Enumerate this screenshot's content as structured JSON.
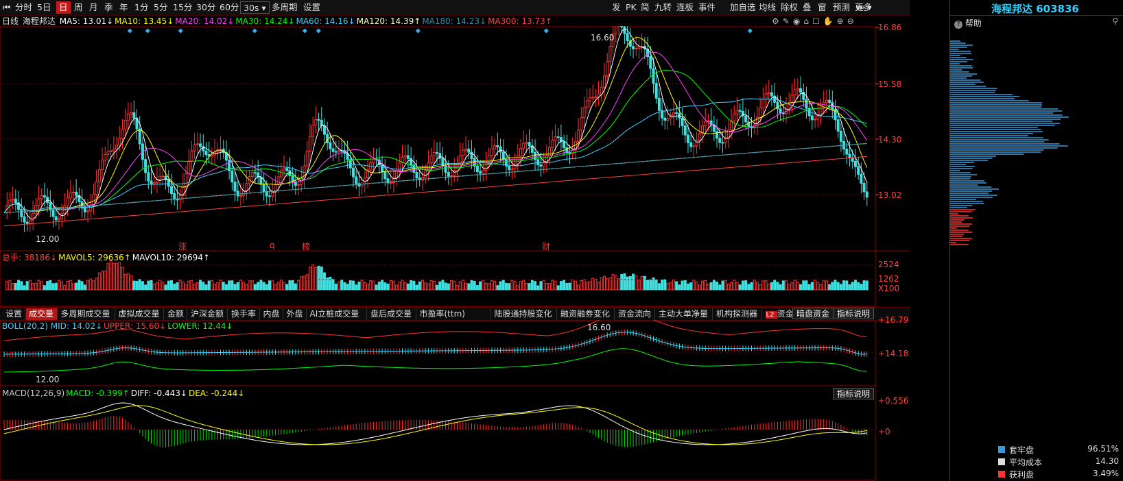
{
  "toolbar": {
    "items": [
      "分时",
      "5日",
      "日",
      "周",
      "月",
      "季",
      "年",
      "1分",
      "5分",
      "15分",
      "30分",
      "60分",
      "30s",
      "多周期",
      "设置"
    ],
    "active_index": 2,
    "right_items": [
      "发",
      "PK",
      "简",
      "九转",
      "连板",
      "事件",
      "加自选",
      "均线",
      "除权",
      "叠",
      "窗",
      "预测",
      "更多"
    ]
  },
  "stock": {
    "name": "海程邦达",
    "code": "603836"
  },
  "main_legend": {
    "period": "日线",
    "name": "海程邦达",
    "items": [
      {
        "text": "MA5: 13.01",
        "arrow": "↓",
        "color": "#ffffff"
      },
      {
        "text": "MA10: 13.45",
        "arrow": "↓",
        "color": "#ffff00"
      },
      {
        "text": "MA20: 14.02",
        "arrow": "↓",
        "color": "#ff40ff"
      },
      {
        "text": "MA30: 14.24",
        "arrow": "↓",
        "color": "#00ff00"
      },
      {
        "text": "MA60: 14.16",
        "arrow": "↓",
        "color": "#40d0ff"
      },
      {
        "text": "MA120: 14.39",
        "arrow": "↑",
        "color": "#ffffc0"
      },
      {
        "text": "MA180: 14.23",
        "arrow": "↓",
        "color": "#3a8fa8"
      },
      {
        "text": "MA300: 13.73",
        "arrow": "↑",
        "color": "#ff4040"
      }
    ]
  },
  "price_axis": [
    "16.86",
    "15.58",
    "14.30",
    "13.02"
  ],
  "annotations": {
    "high": "16.60",
    "low": "12.00",
    "events": [
      "涨",
      "q",
      "榜",
      "财"
    ]
  },
  "volume_legend": {
    "items": [
      {
        "text": "总手: 38186",
        "arrow": "↓",
        "color": "#ff4040"
      },
      {
        "text": "MAVOL5: 29636",
        "arrow": "↑",
        "color": "#ffff00"
      },
      {
        "text": "MAVOL10: 29694",
        "arrow": "↑",
        "color": "#ffffff"
      }
    ]
  },
  "volume_axis": [
    "2524",
    "1262",
    "X100"
  ],
  "tabs": [
    "设置",
    "成交量",
    "多周期成交量",
    "虚拟成交量",
    "金额",
    "沪深金额",
    "换手率",
    "内盘",
    "外盘",
    "AI立桩成交量",
    "盘后成交量",
    "市盈率(ttm)",
    "陆股通持股变化",
    "融资融券变化",
    "资金流向",
    "主动大单净量",
    "机构探测器",
    "资金抄底"
  ],
  "tabs_active_index": 1,
  "boll_legend": {
    "items": [
      {
        "text": "BOLL(20,2) MID: 14.02",
        "arrow": "↓",
        "color": "#40d0ff"
      },
      {
        "text": "UPPER: 15.60",
        "arrow": "↓",
        "color": "#ff4040"
      },
      {
        "text": "LOWER: 12.44",
        "arrow": "↓",
        "color": "#00ff00"
      }
    ]
  },
  "boll_axis": [
    "+16.79",
    "+14.18"
  ],
  "boll_annotations": {
    "high": "16.60",
    "low": "12.00"
  },
  "boll_buttons": [
    "暗盘资金",
    "指标说明"
  ],
  "macd_legend": {
    "items": [
      {
        "text": "MACD(12,26,9)",
        "arrow": "",
        "color": "#c8c8c8"
      },
      {
        "text": "MACD: -0.399",
        "arrow": "↑",
        "color": "#00ff00"
      },
      {
        "text": "DIFF: -0.443",
        "arrow": "↓",
        "color": "#ffffff"
      },
      {
        "text": "DEA: -0.244",
        "arrow": "↓",
        "color": "#ffff00"
      }
    ]
  },
  "macd_axis": [
    "+0.556",
    "+0"
  ],
  "macd_buttons": [
    "指标说明"
  ],
  "chip_panel": {
    "help": "帮助",
    "legend": [
      {
        "label": "套牢盘",
        "value": "96.51%",
        "color": "#3a9ad9"
      },
      {
        "label": "平均成本",
        "value": "14.30",
        "color": "#dddddd"
      },
      {
        "label": "获利盘",
        "value": "3.49%",
        "color": "#ff3030"
      }
    ]
  },
  "colors": {
    "up": "#ff3030",
    "down": "#40e0e0",
    "grid": "#7a0000"
  }
}
